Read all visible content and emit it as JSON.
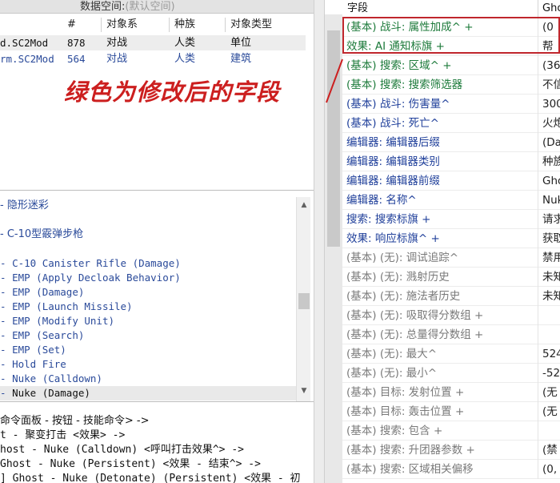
{
  "data_space": {
    "label": "数据空间:",
    "value": "(默认空间)"
  },
  "mod_table": {
    "columns": [
      "#",
      "对象系",
      "种族",
      "对象类型"
    ],
    "rows": [
      {
        "name": "d.SC2Mod",
        "num": "878",
        "system": "对战",
        "race": "人类",
        "type": "单位"
      },
      {
        "name": "rm.SC2Mod",
        "num": "564",
        "system": "对战",
        "race": "人类",
        "type": "建筑"
      }
    ]
  },
  "list_items": [
    {
      "dash": "-",
      "text": "隐形迷彩"
    },
    {
      "dash": "-",
      "text": "C-10型霰弹步枪"
    },
    {
      "dash": "-",
      "text": "C-10 Canister Rifle (Damage)"
    },
    {
      "dash": "-",
      "text": "EMP (Apply Decloak Behavior)"
    },
    {
      "dash": "-",
      "text": "EMP (Damage)"
    },
    {
      "dash": "-",
      "text": "EMP (Launch Missile)"
    },
    {
      "dash": "-",
      "text": "EMP (Modify Unit)"
    },
    {
      "dash": "-",
      "text": "EMP (Search)"
    },
    {
      "dash": "-",
      "text": "EMP (Set)"
    },
    {
      "dash": "-",
      "text": "Hold Fire"
    },
    {
      "dash": "-",
      "text": "Nuke (Calldown)"
    },
    {
      "dash": "-",
      "text": "Nuke (Damage)"
    }
  ],
  "command_lines": [
    "命令面板 - 按钮 - 技能命令> ->",
    "t - 聚变打击 <效果> ->",
    "host - Nuke (Calldown) <呼叫打击效果^> ->",
    " Ghost - Nuke (Persistent) <效果 - 结束^> ->",
    "] Ghost - Nuke (Detonate) (Persistent) <效果 - 初"
  ],
  "right": {
    "header_field": "字段",
    "header_ghost": "Gho",
    "rows": [
      {
        "field": "(基本) 战斗: 属性加成^ +",
        "value": "(0",
        "style": "green"
      },
      {
        "field": "效果: AI 通知标旗 +",
        "value": "帮",
        "style": "green"
      },
      {
        "field": "(基本) 搜索: 区域^ +",
        "value": "(36",
        "style": "green"
      },
      {
        "field": "(基本) 搜索: 搜索筛选器",
        "value": "不信",
        "style": "green"
      },
      {
        "field": "(基本) 战斗: 伤害量^",
        "value": "300",
        "style": "blue"
      },
      {
        "field": "(基本) 战斗: 死亡^",
        "value": "火炮",
        "style": "blue"
      },
      {
        "field": "编辑器: 编辑器后缀",
        "value": "(Da",
        "style": "blue"
      },
      {
        "field": "编辑器: 编辑器类别",
        "value": "种族",
        "style": "blue"
      },
      {
        "field": "编辑器: 编辑器前缀",
        "value": "Gho",
        "style": "blue"
      },
      {
        "field": "编辑器: 名称^",
        "value": "Nuk",
        "style": "blue"
      },
      {
        "field": "搜索: 搜索标旗 +",
        "value": "请求",
        "style": "blue"
      },
      {
        "field": "效果: 响应标旗^ +",
        "value": "获取",
        "style": "blue"
      },
      {
        "field": "(基本) (无): 调试追踪^",
        "value": "禁用",
        "style": "gray"
      },
      {
        "field": "(基本) (无): 溅射历史",
        "value": "未知",
        "style": "gray"
      },
      {
        "field": "(基本) (无): 施法者历史",
        "value": "未知",
        "style": "gray"
      },
      {
        "field": "(基本) (无): 吸取得分数组 +",
        "value": "",
        "style": "gray"
      },
      {
        "field": "(基本) (无): 总量得分数组 +",
        "value": "",
        "style": "gray"
      },
      {
        "field": "(基本) (无): 最大^",
        "value": "524",
        "style": "gray"
      },
      {
        "field": "(基本) (无): 最小^",
        "value": "-52",
        "style": "gray"
      },
      {
        "field": "(基本) 目标: 发射位置 +",
        "value": "(无",
        "style": "gray"
      },
      {
        "field": "(基本) 目标: 轰击位置 +",
        "value": "(无",
        "style": "gray"
      },
      {
        "field": "(基本) 搜索: 包含 +",
        "value": "",
        "style": "gray"
      },
      {
        "field": "(基本) 搜索: 升团器参数 +",
        "value": "(禁",
        "style": "gray"
      },
      {
        "field": "(基本) 搜索: 区域相关偏移",
        "value": "(0,",
        "style": "gray"
      }
    ]
  },
  "annotation": "绿色为修改后的字段",
  "colors": {
    "highlight": "#c0272d",
    "annotation": "#cc1f1f",
    "green_field": "#1c7a3a",
    "gray_field": "#7a7a7a"
  }
}
